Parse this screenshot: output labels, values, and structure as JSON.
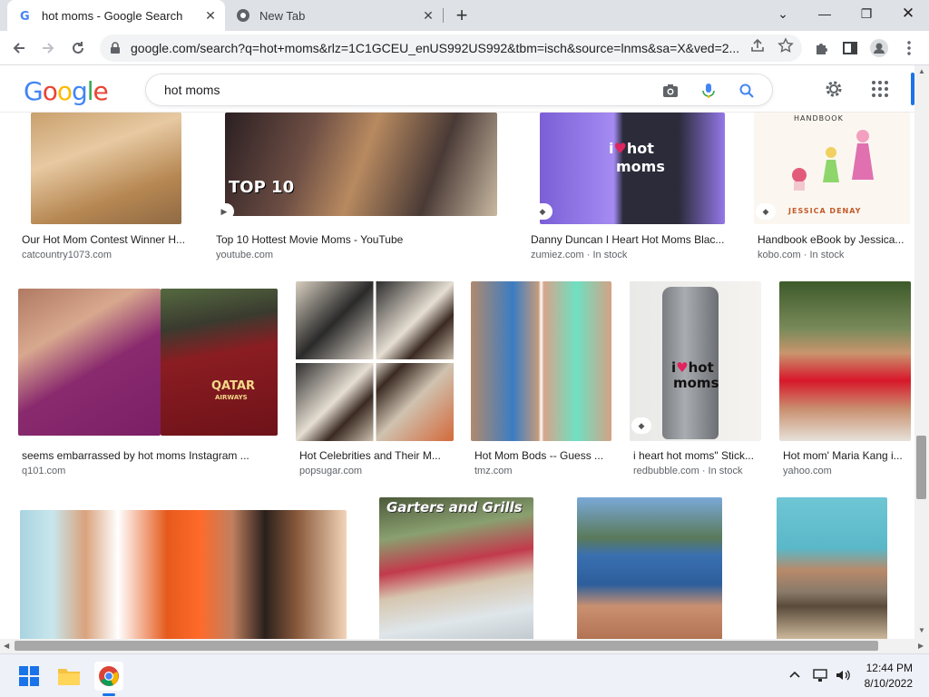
{
  "browser": {
    "tabs": [
      {
        "title": "hot moms - Google Search"
      },
      {
        "title": "New Tab"
      }
    ],
    "url": "google.com/search?q=hot+moms&rlz=1C1GCEU_enUS992US992&tbm=isch&source=lnms&sa=X&ved=2..."
  },
  "google": {
    "logo": "Google",
    "query": "hot moms"
  },
  "results": {
    "row1": [
      {
        "caption": "Our Hot Mom Contest Winner H...",
        "source": "catcountry1073.com",
        "stock": ""
      },
      {
        "caption": "Top 10 Hottest Movie Moms - YouTube",
        "source": "youtube.com",
        "stock": "",
        "overlay": "TOP 10"
      },
      {
        "caption": "Danny Duncan I Heart Hot Moms Blac...",
        "source": "zumiez.com",
        "stock": " · In stock",
        "overlay_i": "i",
        "overlay_hot": "hot",
        "overlay_moms": "moms"
      },
      {
        "caption": "Handbook eBook by Jessica...",
        "source": "kobo.com",
        "stock": " · In stock",
        "overlay": "HANDBOOK",
        "overlay2": "JESSICA DENAY"
      }
    ],
    "row2": [
      {
        "caption": "seems embarrassed by hot moms Instagram ...",
        "source": "q101.com",
        "stock": "",
        "overlay": "QATAR",
        "overlay2": "AIRWAYS"
      },
      {
        "caption": "Hot Celebrities and Their M...",
        "source": "popsugar.com",
        "stock": ""
      },
      {
        "caption": "Hot Mom Bods -- Guess ...",
        "source": "tmz.com",
        "stock": ""
      },
      {
        "caption": "i heart hot moms\" Stick...",
        "source": "redbubble.com",
        "stock": " · In stock",
        "overlay_i": "i",
        "overlay_hot": "hot",
        "overlay_moms": "moms"
      },
      {
        "caption": "Hot mom' Maria Kang i...",
        "source": "yahoo.com",
        "stock": ""
      }
    ],
    "row3": [
      {
        "caption": ""
      },
      {
        "caption": "",
        "overlay": "Garters and Grills"
      },
      {
        "caption": ""
      },
      {
        "caption": ""
      }
    ]
  },
  "taskbar": {
    "time": "12:44 PM",
    "date": "8/10/2022"
  },
  "colors": {
    "accent": "#1a73e8",
    "tabbar": "#dee1e6"
  }
}
